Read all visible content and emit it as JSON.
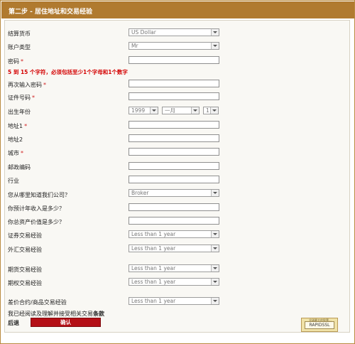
{
  "header": {
    "title": "第二步 - 居住地址和交易经验"
  },
  "fields": {
    "currency": {
      "label": "结算货币",
      "value": "US Dollar"
    },
    "account_type": {
      "label": "账户类型",
      "value": "Mr"
    },
    "password": {
      "label": "密码",
      "required": "*"
    },
    "password_hint": "5 到 15 个字符，必须包括至少1个字母和1个数字",
    "password_repeat": {
      "label": "再次输入密码",
      "required": "*"
    },
    "id_number": {
      "label": "证件号码",
      "required": "*"
    },
    "birth_year": {
      "label": "出生年份",
      "year": "1999",
      "month": "一月",
      "day": "1"
    },
    "address1": {
      "label": "地址1",
      "required": "*"
    },
    "address2": {
      "label": "地址2"
    },
    "city": {
      "label": "城市",
      "required": "*"
    },
    "postal_code": {
      "label": "邮政编码"
    },
    "industry": {
      "label": "行业"
    },
    "source": {
      "label": "您从哪里知道我们公司？",
      "value": "Broker"
    },
    "annual_income": {
      "label": "你预计年收入是多少？"
    },
    "total_assets": {
      "label": "你总资产价值是多少？"
    },
    "securities_exp": {
      "label": "证券交易经验",
      "value": "Less than 1 year"
    },
    "forex_exp": {
      "label": "外汇交易经验",
      "value": "Less than 1 year"
    },
    "futures_exp": {
      "label": "期货交易经验",
      "value": "Less than 1 year"
    },
    "options_exp": {
      "label": "期权交易经验",
      "value": "Less than 1 year"
    },
    "cfd_exp": {
      "label": "差价合约/商品交易经验",
      "value": "Less than 1 year"
    }
  },
  "terms": {
    "text": "我已经阅读及理解并接受相关交易",
    "link": "条款"
  },
  "actions": {
    "back": "后退",
    "confirm": "确认"
  },
  "badge": {
    "top": "全球最大的股票...",
    "label": "RAPIDSSL"
  }
}
